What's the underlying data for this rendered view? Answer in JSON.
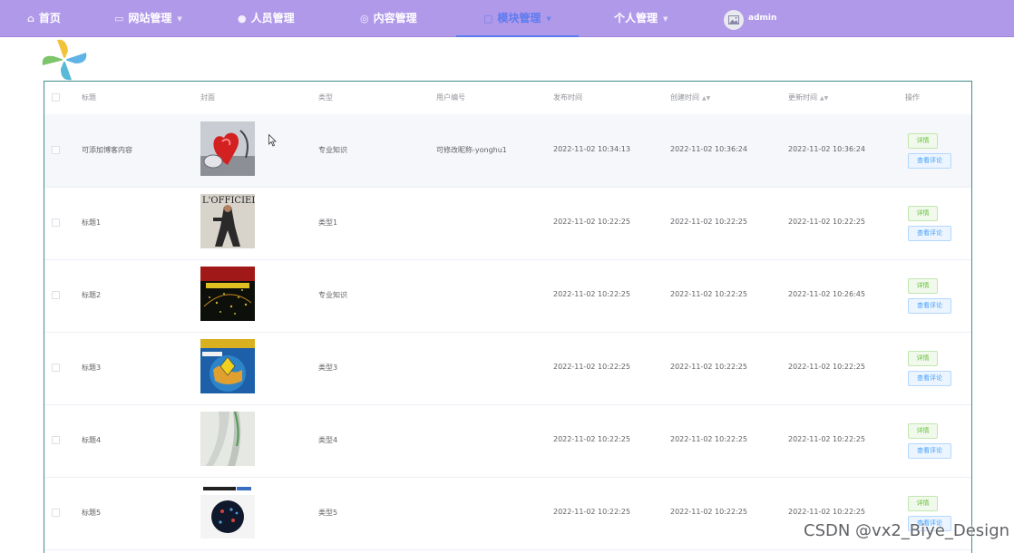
{
  "nav": {
    "items": [
      {
        "label": "首页",
        "icon": "home-icon"
      },
      {
        "label": "网站管理",
        "icon": "monitor-icon"
      },
      {
        "label": "人员管理",
        "icon": "user-icon"
      },
      {
        "label": "内容管理",
        "icon": "content-icon"
      },
      {
        "label": "模块管理",
        "icon": "chat-icon"
      },
      {
        "label": "个人管理",
        "icon": "profile-icon"
      }
    ],
    "active": "模块管理",
    "user_name": "admin",
    "colors": {
      "bar": "#b199ea",
      "active": "#5b7bf0"
    }
  },
  "table": {
    "headers": {
      "title": "标题",
      "cover": "封面",
      "type": "类型",
      "user_no": "用户编号",
      "publish_time": "发布时间",
      "create_time": "创建时间",
      "update_time": "更新时间",
      "action": "操作"
    },
    "rows": [
      {
        "title": "可添加博客内容",
        "type": "专业知识",
        "user_no": "可修改昵称-yonghu1",
        "publish_time": "2022-11-02 10:34:13",
        "create_time": "2022-11-02 10:36:24",
        "update_time": "2022-11-02 10:36:24",
        "cover": "heart-stethoscope-image"
      },
      {
        "title": "标题1",
        "type": "类型1",
        "user_no": "",
        "publish_time": "2022-11-02 10:22:25",
        "create_time": "2022-11-02 10:22:25",
        "update_time": "2022-11-02 10:22:25",
        "cover": "fashion-magazine-image"
      },
      {
        "title": "标题2",
        "type": "专业知识",
        "user_no": "",
        "publish_time": "2022-11-02 10:22:25",
        "create_time": "2022-11-02 10:22:25",
        "update_time": "2022-11-02 10:26:45",
        "cover": "science-magazine-image"
      },
      {
        "title": "标题3",
        "type": "类型3",
        "user_no": "",
        "publish_time": "2022-11-02 10:22:25",
        "create_time": "2022-11-02 10:22:25",
        "update_time": "2022-11-02 10:22:25",
        "cover": "globe-magazine-image"
      },
      {
        "title": "标题4",
        "type": "类型4",
        "user_no": "",
        "publish_time": "2022-11-02 10:22:25",
        "create_time": "2022-11-02 10:22:25",
        "update_time": "2022-11-02 10:22:25",
        "cover": "abstract-paper-image"
      },
      {
        "title": "标题5",
        "type": "类型5",
        "user_no": "",
        "publish_time": "2022-11-02 10:22:25",
        "create_time": "2022-11-02 10:22:25",
        "update_time": "2022-11-02 10:22:25",
        "cover": "chemistry-journal-image"
      }
    ],
    "buttons": {
      "detail": "详情",
      "comments": "查看评论"
    }
  },
  "watermark": "CSDN @vx2_Biye_Design"
}
